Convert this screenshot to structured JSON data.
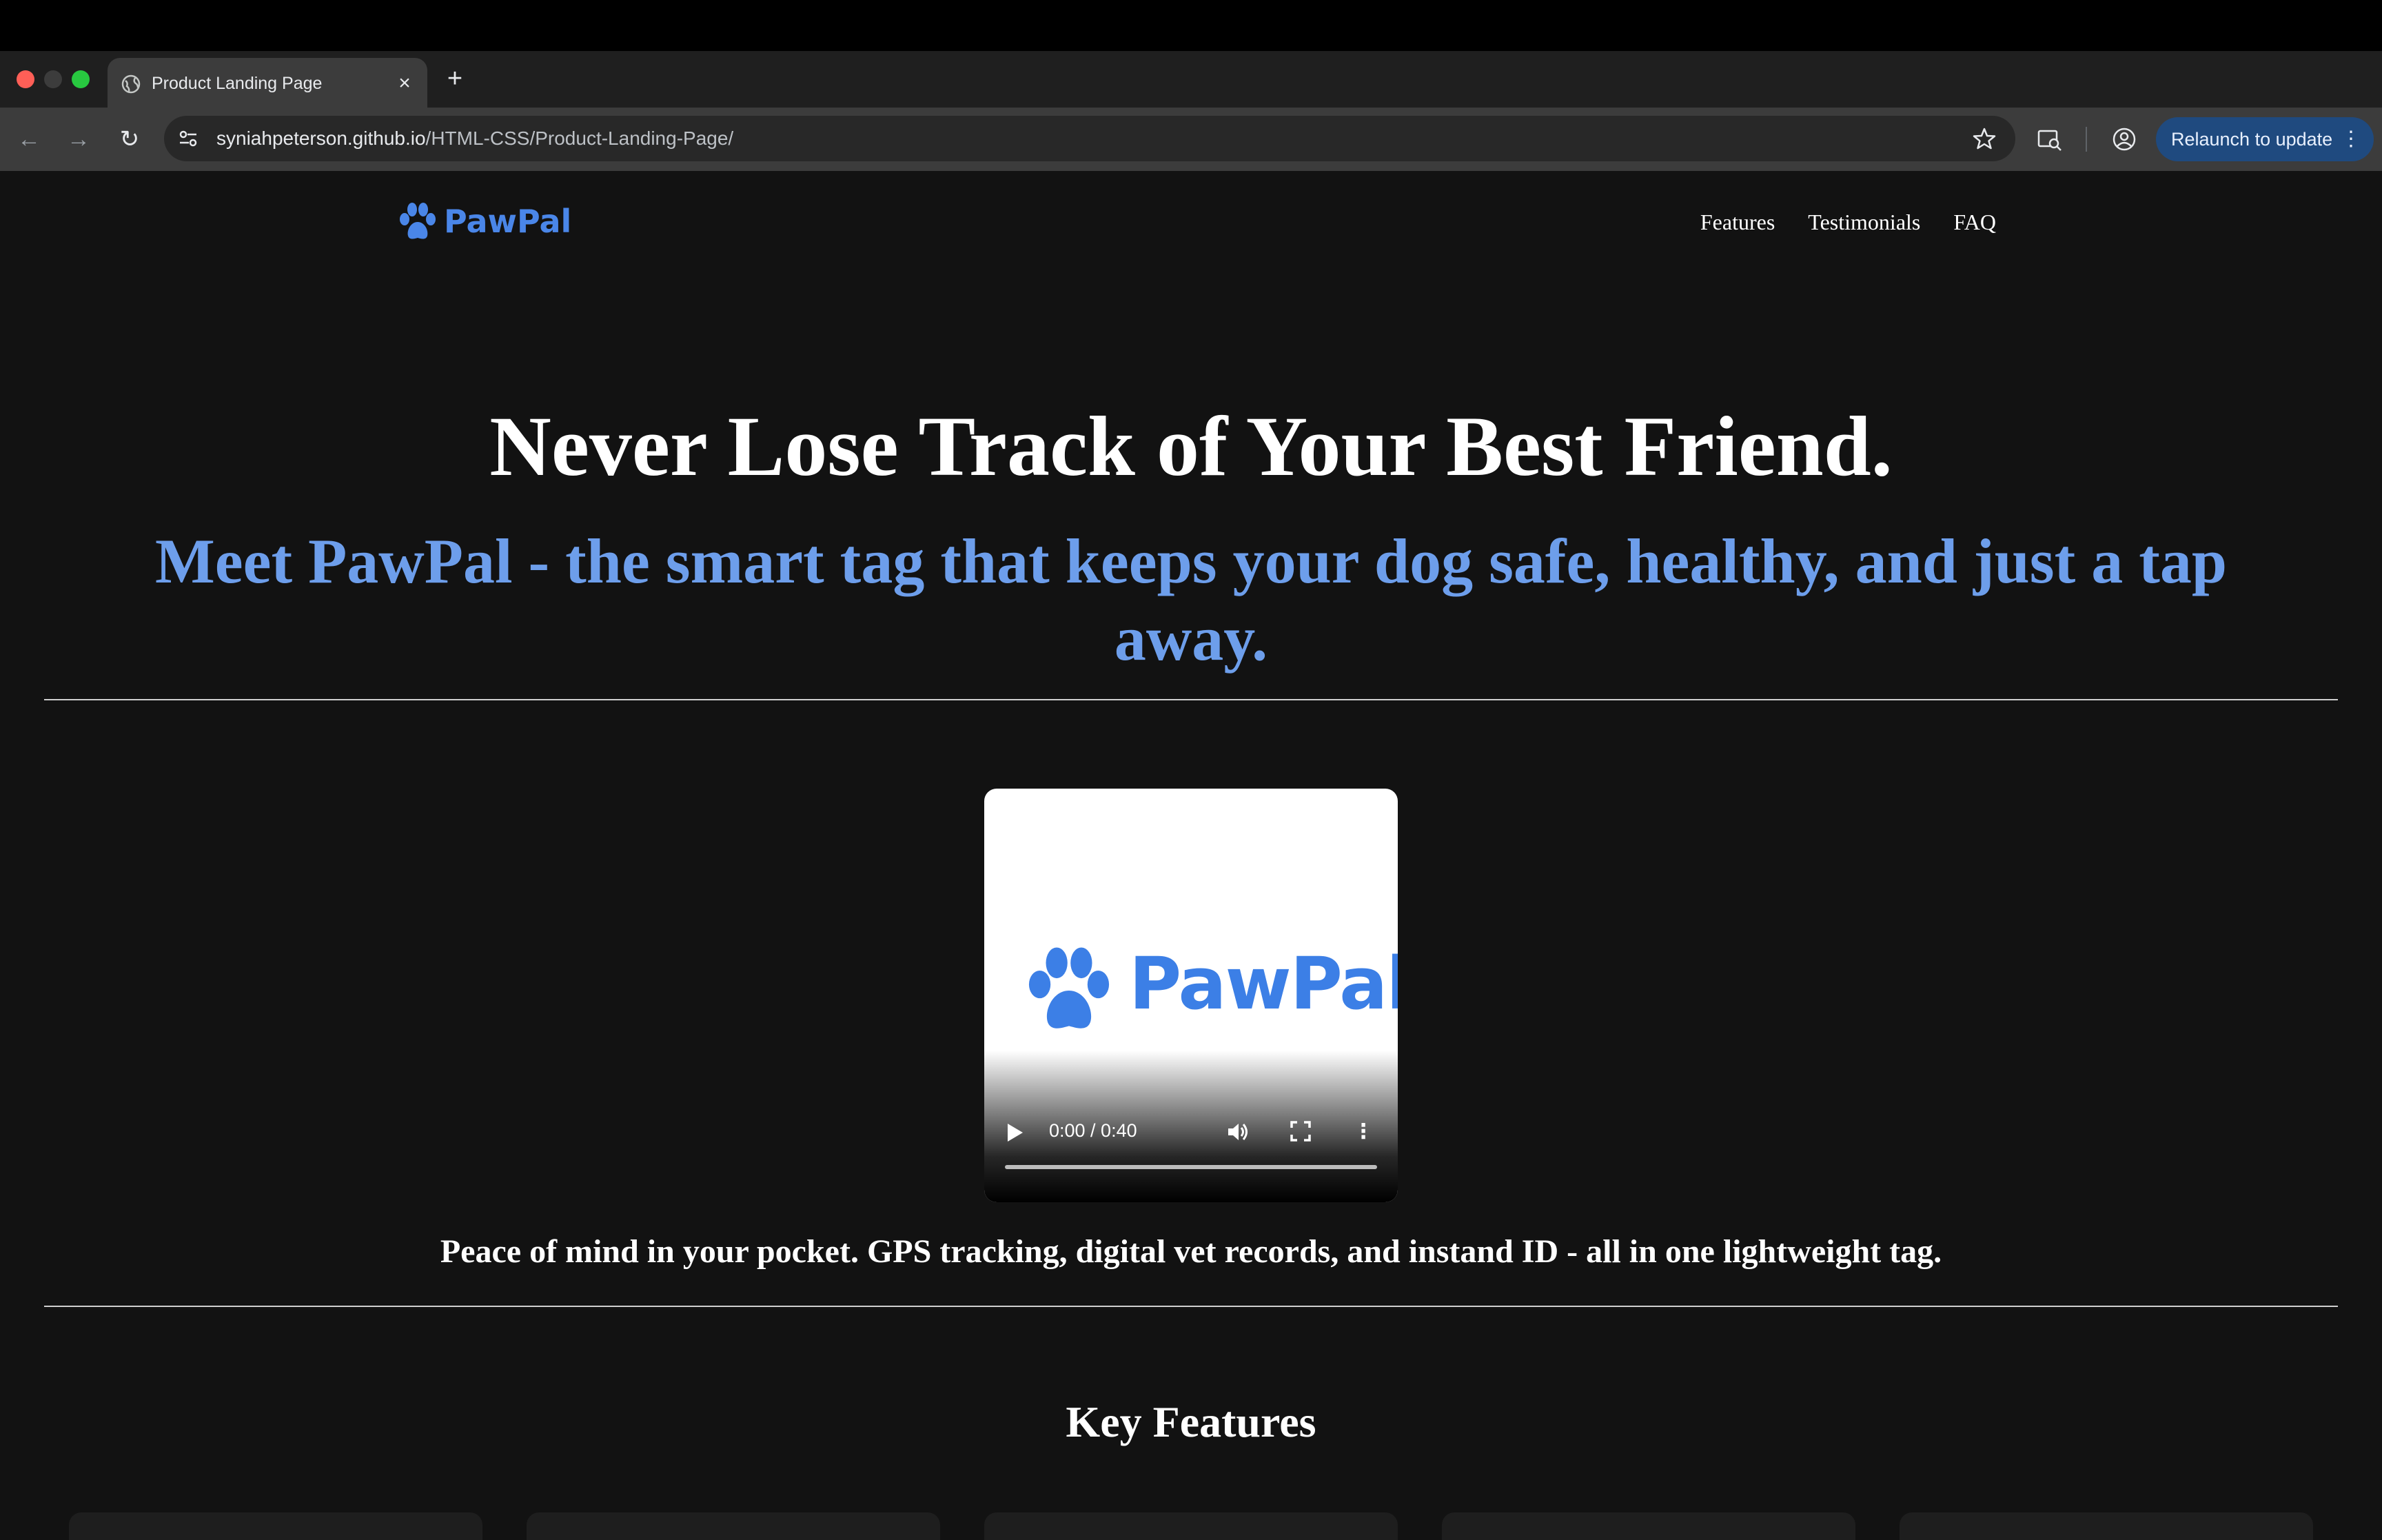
{
  "browser": {
    "tab_title": "Product Landing Page",
    "tab_close": "×",
    "new_tab": "+",
    "url_host": "syniahpeterson.github.io",
    "url_path": "/HTML-CSS/Product-Landing-Page/",
    "back": "←",
    "forward": "→",
    "reload": "↻",
    "relaunch_label": "Relaunch to update",
    "menu_dots": "⋮"
  },
  "header": {
    "brand_name": "PawPal",
    "nav": [
      "Features",
      "Testimonials",
      "FAQ"
    ]
  },
  "hero": {
    "title": "Never Lose Track of Your Best Friend.",
    "subtitle": "Meet PawPal - the smart tag that keeps your dog safe, healthy, and just a tap away."
  },
  "video": {
    "brand_name": "PawPal",
    "time": "0:00 / 0:40",
    "progress": 0,
    "more": "⋮"
  },
  "tagline": "Peace of mind in your pocket. GPS tracking, digital vet records, and instand ID - all in one lightweight tag.",
  "features": {
    "heading": "Key Features",
    "card_count_visible": 5
  },
  "colors": {
    "brand_blue": "#4a86e8",
    "subtitle_blue": "#6d9eeb",
    "page_bg": "#121212",
    "relaunch_bg": "#1f4a7f"
  }
}
